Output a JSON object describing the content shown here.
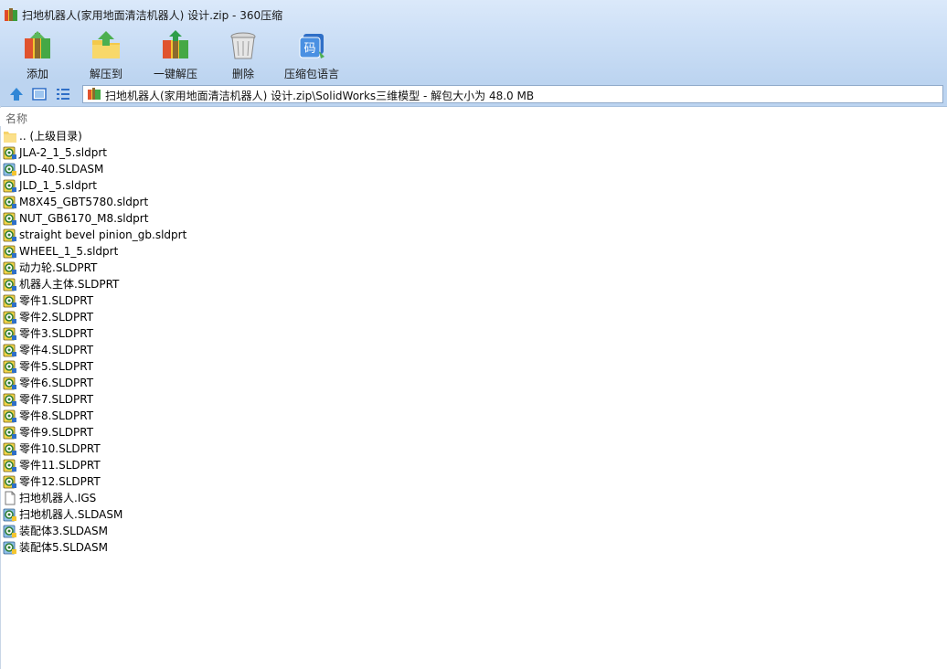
{
  "window": {
    "title": "扫地机器人(家用地面清洁机器人) 设计.zip - 360压缩"
  },
  "toolbar": [
    {
      "label": "添加",
      "icon": "add-archive-icon"
    },
    {
      "label": "解压到",
      "icon": "extract-to-icon"
    },
    {
      "label": "一键解压",
      "icon": "one-click-extract-icon"
    },
    {
      "label": "删除",
      "icon": "delete-trash-icon"
    },
    {
      "label": "压缩包语言",
      "icon": "archive-language-icon",
      "icon_text": "码"
    }
  ],
  "address": {
    "path": "扫地机器人(家用地面清洁机器人) 设计.zip\\SolidWorks三维模型 - 解包大小为 48.0 MB"
  },
  "list": {
    "column_name": "名称",
    "files": [
      {
        "name": ".. (上级目录)",
        "type": "folder"
      },
      {
        "name": "JLA-2_1_5.sldprt",
        "type": "part"
      },
      {
        "name": "JLD-40.SLDASM",
        "type": "assembly"
      },
      {
        "name": "JLD_1_5.sldprt",
        "type": "part"
      },
      {
        "name": "M8X45_GBT5780.sldprt",
        "type": "part"
      },
      {
        "name": "NUT_GB6170_M8.sldprt",
        "type": "part"
      },
      {
        "name": "straight bevel pinion_gb.sldprt",
        "type": "part"
      },
      {
        "name": "WHEEL_1_5.sldprt",
        "type": "part"
      },
      {
        "name": "动力轮.SLDPRT",
        "type": "part"
      },
      {
        "name": "机器人主体.SLDPRT",
        "type": "part"
      },
      {
        "name": "零件1.SLDPRT",
        "type": "part"
      },
      {
        "name": "零件2.SLDPRT",
        "type": "part"
      },
      {
        "name": "零件3.SLDPRT",
        "type": "part"
      },
      {
        "name": "零件4.SLDPRT",
        "type": "part"
      },
      {
        "name": "零件5.SLDPRT",
        "type": "part"
      },
      {
        "name": "零件6.SLDPRT",
        "type": "part"
      },
      {
        "name": "零件7.SLDPRT",
        "type": "part"
      },
      {
        "name": "零件8.SLDPRT",
        "type": "part"
      },
      {
        "name": "零件9.SLDPRT",
        "type": "part"
      },
      {
        "name": "零件10.SLDPRT",
        "type": "part"
      },
      {
        "name": "零件11.SLDPRT",
        "type": "part"
      },
      {
        "name": "零件12.SLDPRT",
        "type": "part"
      },
      {
        "name": "扫地机器人.IGS",
        "type": "generic"
      },
      {
        "name": "扫地机器人.SLDASM",
        "type": "assembly"
      },
      {
        "name": "装配体3.SLDASM",
        "type": "assembly"
      },
      {
        "name": "装配体5.SLDASM",
        "type": "assembly"
      }
    ]
  }
}
